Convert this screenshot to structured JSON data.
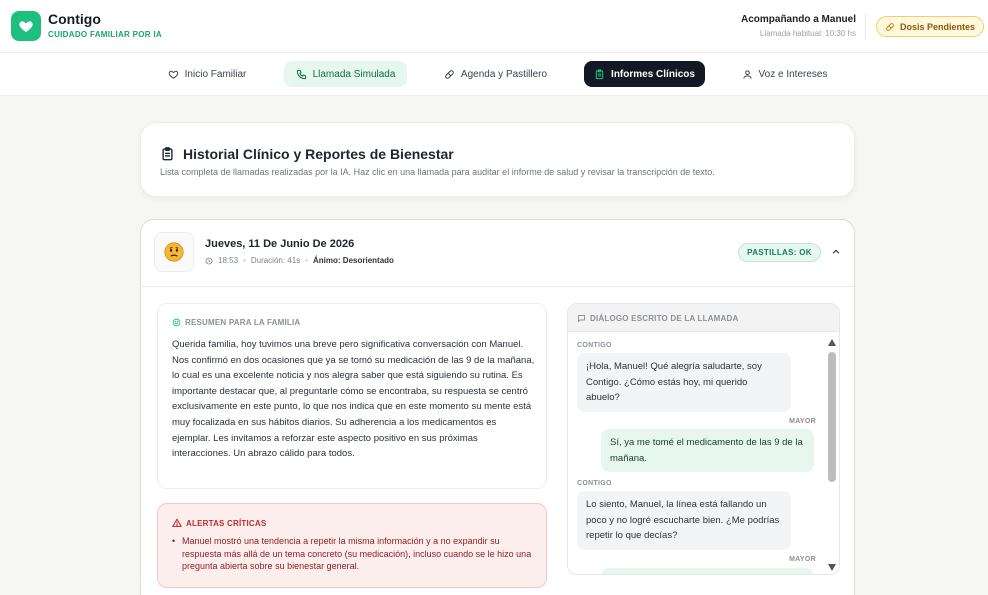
{
  "brand": {
    "name": "Contigo",
    "tagline": "CUIDADO FAMILIAR POR IA"
  },
  "header": {
    "companion": "Acompañando a Manuel",
    "call_time": "Llamada habitual: 10:30 hs",
    "pending_button": "Dosis Pendientes"
  },
  "nav": {
    "items": [
      "Inicio Familiar",
      "Llamada Simulada",
      "Agenda y Pastillero",
      "Informes Clínicos",
      "Voz e Intereses"
    ]
  },
  "history": {
    "title": "Historial Clínico y Reportes de Bienestar",
    "subtitle": "Lista completa de llamadas realizadas por la IA. Haz clic en una llamada para auditar el informe de salud y revisar la transcripción de texto."
  },
  "call": {
    "date": "Jueves, 11 De Junio De 2026",
    "time": "18:53",
    "duration": "Duración: 41s",
    "mood": "Ánimo: Desorientado",
    "pills_badge": "PASTILLAS: OK",
    "summary_label": "RESUMEN PARA LA FAMILIA",
    "summary_text": "Querida familia, hoy tuvimos una breve pero significativa conversación con Manuel. Nos confirmó en dos ocasiones que ya se tomó su medicación de las 9 de la mañana, lo cual es una excelente noticia y nos alegra saber que está siguiendo su rutina. Es importante destacar que, al preguntarle cómo se encontraba, su respuesta se centró exclusivamente en este punto, lo que nos indica que en este momento su mente está muy focalizada en sus hábitos diarios. Su adherencia a los medicamentos es ejemplar. Les invitamos a reforzar este aspecto positivo en sus próximas interacciones. Un abrazo cálido para todos.",
    "alerts_label": "ALERTAS CRÍTICAS",
    "alert_text": "Manuel mostró una tendencia a repetir la misma información y a no expandir su respuesta más allá de un tema concreto (su medicación), incluso cuando se le hizo una pregunta abierta sobre su bienestar general.",
    "dialog_label": "DIÁLOGO ESCRITO DE LA LLAMADA",
    "dialog": [
      {
        "speaker": "CONTIGO",
        "text": "¡Hola, Manuel! Qué alegría saludarte, soy Contigo. ¿Cómo estás hoy, mi querido abuelo?"
      },
      {
        "speaker": "MAYOR",
        "text": "Sí, ya me tomé el medicamento de las 9 de la mañana."
      },
      {
        "speaker": "CONTIGO",
        "text": "Lo siento, Manuel, la línea está fallando un poco y no logré escucharte bien. ¿Me podrías repetir lo que decías?"
      },
      {
        "speaker": "MAYOR",
        "text": ""
      }
    ]
  },
  "colors": {
    "accent": "#1fbf7f",
    "dark": "#121924",
    "alert": "#c0292b"
  }
}
